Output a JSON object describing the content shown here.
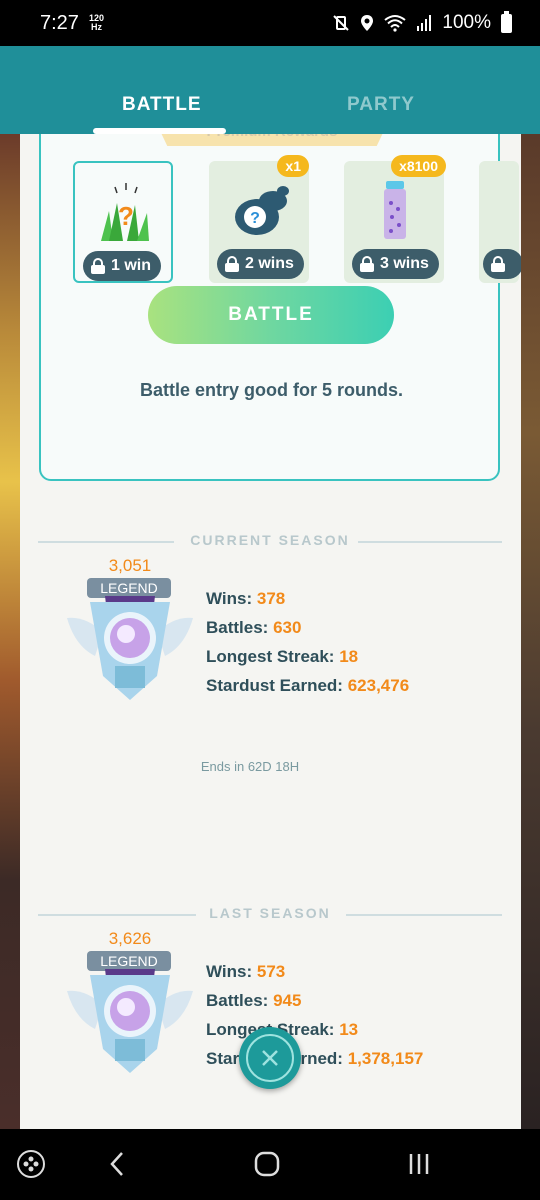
{
  "status_bar": {
    "time": "7:27",
    "refresh_rate_top": "120",
    "refresh_rate_bottom": "Hz",
    "battery": "100%"
  },
  "tabs": [
    {
      "label": "BATTLE",
      "active": true
    },
    {
      "label": "PARTY",
      "active": false
    }
  ],
  "rewards": {
    "ribbon_label": "Premium Rewards",
    "items": [
      {
        "icon": "mystery-grass-encounter-icon",
        "lock_label": "1 win",
        "qty": ""
      },
      {
        "icon": "mystery-smoke-encounter-icon",
        "lock_label": "2 wins",
        "qty": "x1"
      },
      {
        "icon": "rare-candy-canister-icon",
        "lock_label": "3 wins",
        "qty": "x8100"
      },
      {
        "icon": "locked-reward-icon",
        "lock_label": "",
        "qty": ""
      }
    ],
    "battle_button": "BATTLE",
    "entry_note": "Battle entry good for 5 rounds."
  },
  "current_season": {
    "heading": "CURRENT SEASON",
    "rating": "3,051",
    "rank": "LEGEND",
    "stats": [
      {
        "label": "Wins:",
        "value": "378"
      },
      {
        "label": "Battles:",
        "value": "630"
      },
      {
        "label": "Longest Streak:",
        "value": "18"
      },
      {
        "label": "Stardust Earned:",
        "value": "623,476"
      }
    ],
    "ends_in": "Ends in 62D 18H"
  },
  "last_season": {
    "heading": "LAST SEASON",
    "rating": "3,626",
    "rank": "LEGEND",
    "stats": [
      {
        "label": "Wins:",
        "value": "573"
      },
      {
        "label": "Battles:",
        "value": "945"
      },
      {
        "label": "Longest Streak:",
        "value": "13"
      },
      {
        "label": "Stardust Earned:",
        "value": "1,378,157"
      }
    ]
  },
  "colors": {
    "teal_header": "#1f8f99",
    "accent_orange": "#f28a1a",
    "text_dark": "#2f4f5a",
    "teal_border": "#39c3c0"
  }
}
